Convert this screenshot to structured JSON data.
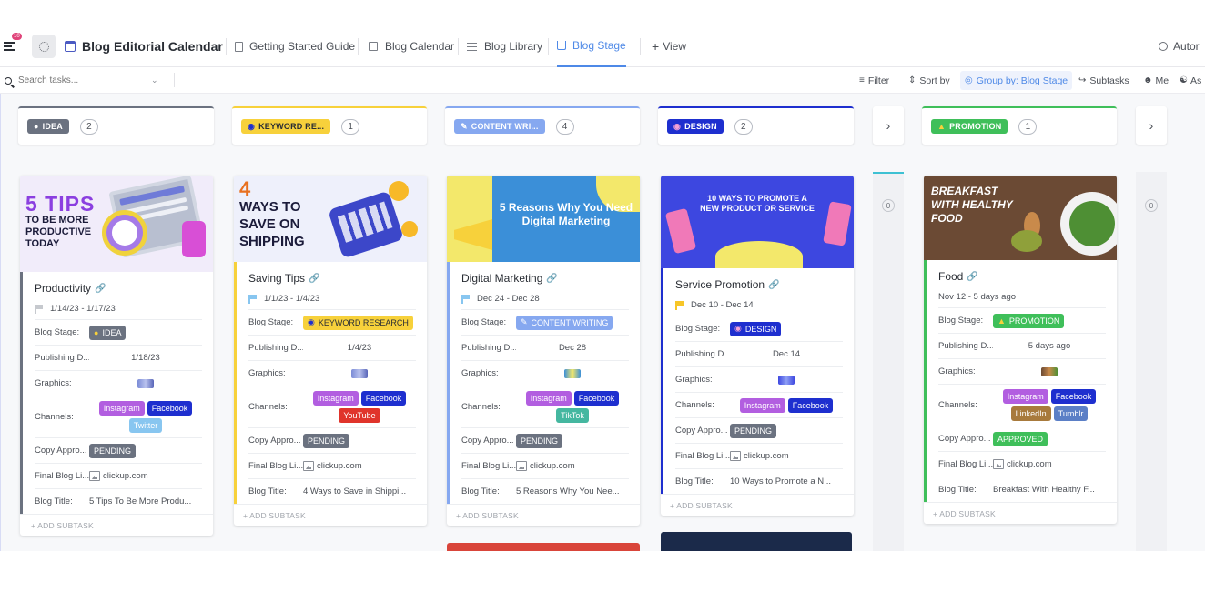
{
  "header": {
    "notification_count": "10",
    "title": "Blog Editorial Calendar",
    "views": [
      {
        "label": "Getting Started Guide"
      },
      {
        "label": "Blog Calendar"
      },
      {
        "label": "Blog Library"
      },
      {
        "label": "Blog Stage",
        "active": true
      }
    ],
    "add_view_label": "View",
    "automations_label": "Autor"
  },
  "toolbar": {
    "search_placeholder": "Search tasks...",
    "filter_label": "Filter",
    "sort_label": "Sort by",
    "group_label": "Group by: Blog Stage",
    "subtasks_label": "Subtasks",
    "me_label": "Me",
    "assignee_label": "As"
  },
  "colors": {
    "accent": "#4e89e7",
    "idea": "#6b7280",
    "keyword": "#f7d13b",
    "content": "#86a8f0",
    "design": "#1e2fcf",
    "promotion": "#3fbf5a",
    "pending": "#6b7280",
    "approved": "#3fbf5a",
    "instagram": "#b25ee0",
    "facebook": "#1e2fcf",
    "twitter": "#88c6f0",
    "youtube": "#e0342b",
    "tiktok": "#45b7a0",
    "linkedin": "#a87a3c",
    "tumblr": "#5b7fc6"
  },
  "columns": [
    {
      "stage": "IDEA",
      "count": "2",
      "icon": "lightbulb-icon"
    },
    {
      "stage": "KEYWORD RE...",
      "count": "1",
      "icon": "magnifier-icon"
    },
    {
      "stage": "CONTENT WRI...",
      "count": "4",
      "icon": "pen-icon"
    },
    {
      "stage": "DESIGN",
      "count": "2",
      "icon": "palette-icon"
    },
    {
      "stage": "collapsed",
      "count": "0"
    },
    {
      "stage": "PROMOTION",
      "count": "1",
      "icon": "megaphone-icon"
    },
    {
      "stage": "collapsed",
      "count": "0"
    }
  ],
  "field_labels": {
    "stage": "Blog Stage:",
    "publishing": "Publishing D...",
    "graphics": "Graphics:",
    "channels": "Channels:",
    "copy": "Copy Appro...",
    "final_link": "Final Blog Li...",
    "blog_title": "Blog Title:",
    "add_subtask": "+ ADD SUBTASK"
  },
  "cards": [
    {
      "cover_text": "5 TIPS",
      "cover_sub": "TO BE MORE PRODUCTIVE TODAY",
      "title": "Productivity",
      "dates": "1/14/23  -  1/17/23",
      "stage": "IDEA",
      "publishing": "1/18/23",
      "channels": [
        "Instagram",
        "Facebook",
        "Twitter"
      ],
      "copy": "PENDING",
      "link": "clickup.com",
      "blog_title": "5 Tips To Be More Produ..."
    },
    {
      "cover_text": "4",
      "cover_sub": "WAYS TO SAVE ON SHIPPING",
      "title": "Saving Tips",
      "dates": "1/1/23  -  1/4/23",
      "stage": "KEYWORD RESEARCH",
      "publishing": "1/4/23",
      "channels": [
        "Instagram",
        "Facebook",
        "YouTube"
      ],
      "copy": "PENDING",
      "link": "clickup.com",
      "blog_title": "4 Ways to Save in Shippi..."
    },
    {
      "cover_text": "5 Reasons Why You Need Digital Marketing",
      "title": "Digital Marketing",
      "dates": "Dec 24  -  Dec 28",
      "stage": "CONTENT WRITING",
      "publishing": "Dec 28",
      "channels": [
        "Instagram",
        "Facebook",
        "TikTok"
      ],
      "copy": "PENDING",
      "link": "clickup.com",
      "blog_title": "5 Reasons Why You Nee..."
    },
    {
      "cover_text": "10 WAYS TO PROMOTE A NEW PRODUCT OR SERVICE",
      "title": "Service Promotion",
      "dates": "Dec 10  -  Dec 14",
      "stage": "DESIGN",
      "publishing": "Dec 14",
      "channels": [
        "Instagram",
        "Facebook"
      ],
      "copy": "PENDING",
      "link": "clickup.com",
      "blog_title": "10 Ways to Promote a N..."
    },
    {
      "cover_text": "BREAKFAST WITH HEALTHY FOOD",
      "title": "Food",
      "dates": "Nov 12  -  5 days ago",
      "stage": "PROMOTION",
      "publishing": "5 days ago",
      "channels": [
        "Instagram",
        "Facebook",
        "LinkedIn",
        "Tumblr"
      ],
      "copy": "APPROVED",
      "link": "clickup.com",
      "blog_title": "Breakfast With Healthy F..."
    }
  ]
}
